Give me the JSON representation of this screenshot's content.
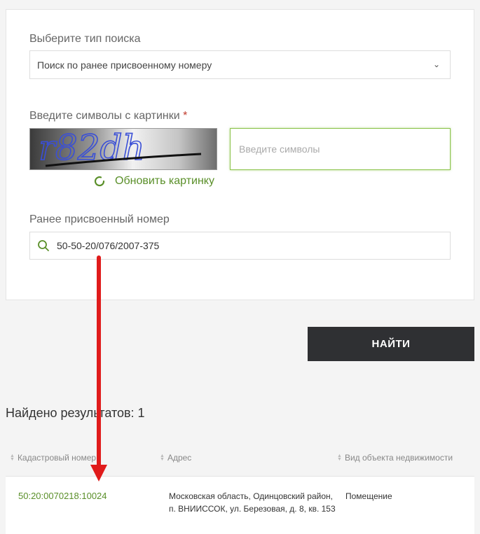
{
  "form": {
    "search_type_label": "Выберите тип поиска",
    "search_type_value": "Поиск по ранее присвоенному номеру",
    "captcha_label": "Введите символы с картинки",
    "required_mark": "*",
    "captcha_text": "r82dh",
    "captcha_placeholder": "Введите символы",
    "refresh_label": "Обновить картинку",
    "prev_number_label": "Ранее присвоенный номер",
    "prev_number_value": "50-50-20/076/2007-375"
  },
  "find_button": "НАЙТИ",
  "results": {
    "count_text": "Найдено результатов: 1",
    "columns": [
      "Кадастровый номер",
      "Адрес",
      "Вид объекта недвижимости"
    ],
    "rows": [
      {
        "cadastral": "50:20:0070218:10024",
        "address_line1": "Московская область, Одинцовский район,",
        "address_line2": "п. ВНИИССОК, ул. Березовая, д. 8, кв. 153",
        "type": "Помещение"
      }
    ]
  },
  "colors": {
    "accent_green": "#5a8f29",
    "button_dark": "#2f3033",
    "annotation_red": "#e01b1b"
  },
  "icons": [
    "chevron-down-icon",
    "refresh-icon",
    "search-icon",
    "sort-icon",
    "arrow-annotation-icon"
  ]
}
